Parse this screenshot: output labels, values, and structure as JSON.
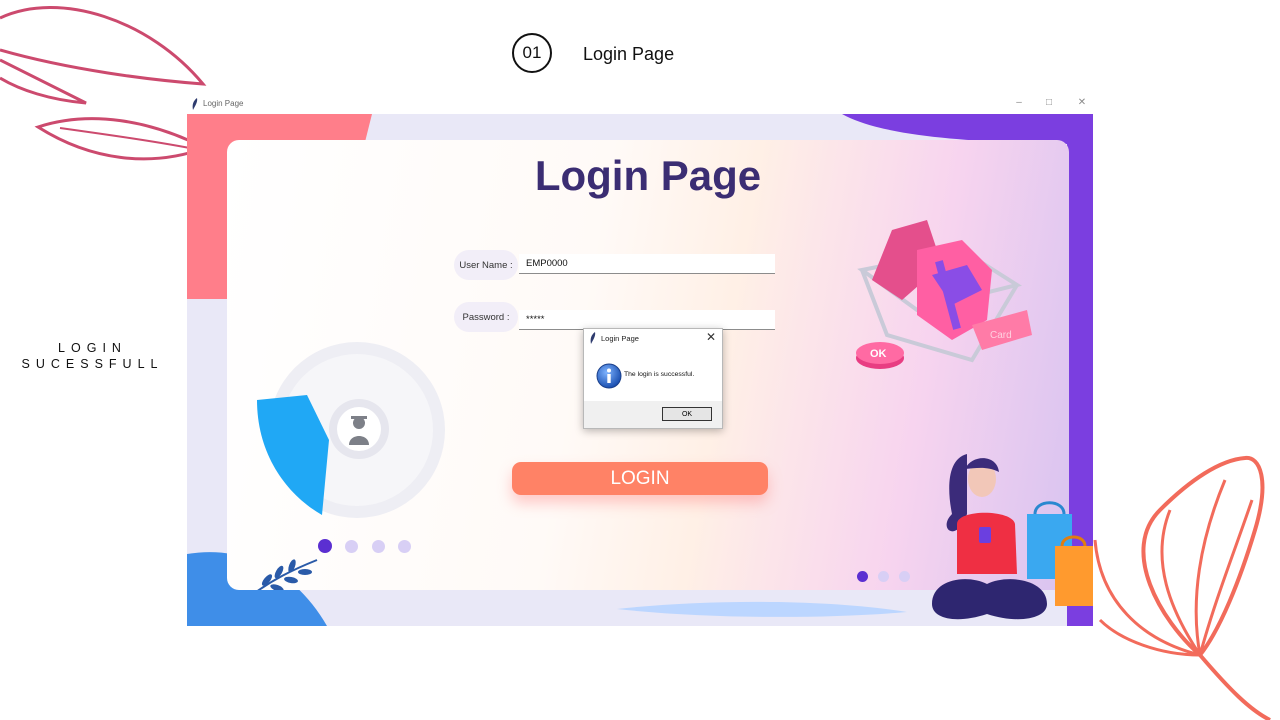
{
  "slide": {
    "step_number": "01",
    "step_title": "Login Page",
    "side_caption_line1": "LOGIN",
    "side_caption_line2": "SUCESSFULL"
  },
  "window": {
    "title": "Login Page",
    "minimize": "–",
    "maximize": "□",
    "close": "✕"
  },
  "login_form": {
    "heading": "Login Page",
    "username_label": "User Name :",
    "username_value": "EMP0000",
    "password_label": "Password :",
    "password_value": "*****",
    "login_button": "LOGIN"
  },
  "dialog": {
    "title": "Login Page",
    "close": "✕",
    "message": "The login is successful.",
    "ok_label": "OK",
    "icon": "info-icon"
  },
  "illustration": {
    "badge_text": "OK",
    "card_text": "Card"
  },
  "colors": {
    "heading": "#3b2d73",
    "login_button": "#ff8266",
    "deco_pink": "#cc4a6e",
    "deco_coral": "#f26b5b",
    "dot_active": "#5b2fd1",
    "dot_inactive": "#d8cff5"
  }
}
